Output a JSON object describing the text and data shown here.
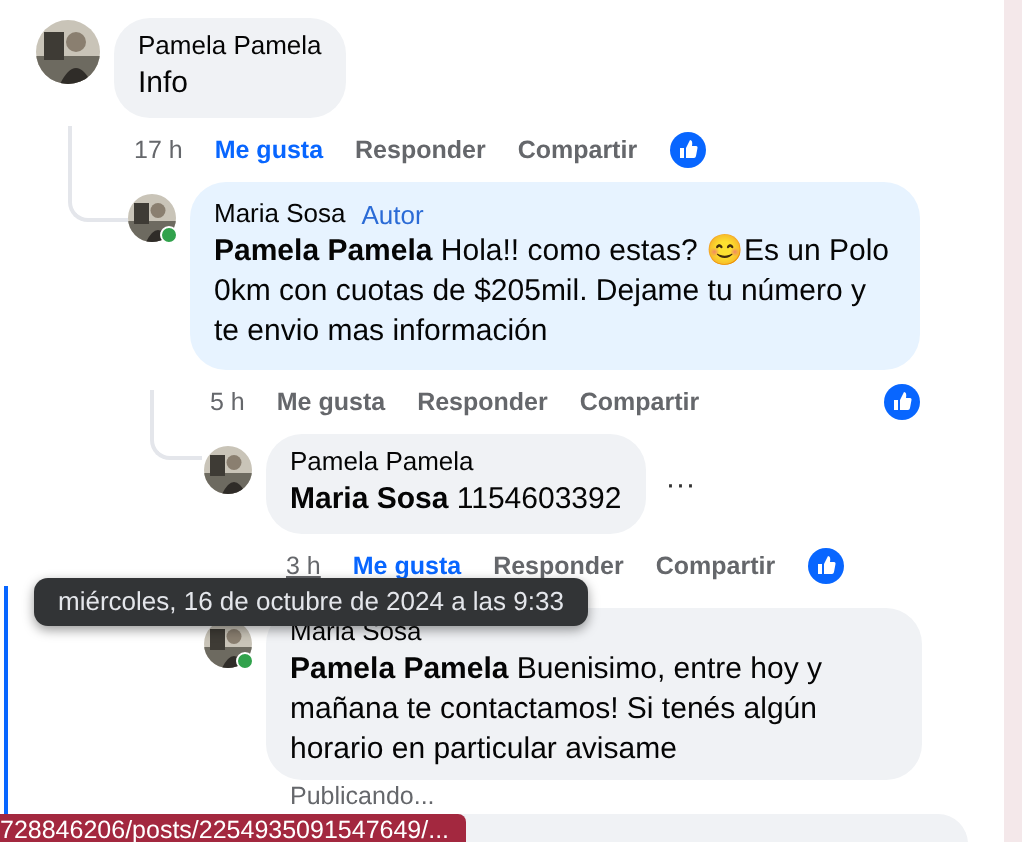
{
  "comments": [
    {
      "kind": "comment",
      "author": "Pamela Pamela",
      "text": "Info",
      "time": "17 h",
      "time_hovered": false,
      "like": "Me gusta",
      "liked": true,
      "reply": "Responder",
      "share": "Compartir",
      "children": [
        {
          "kind": "comment",
          "author": "Maria Sosa",
          "badge": "Autor",
          "text": "**Pamela Pamela** Hola!! como estas? 😊Es un Polo 0km con cuotas de $205mil. Dejame tu número y te envio mas información",
          "time": "5 h",
          "time_hovered": false,
          "like": "Me gusta",
          "liked": false,
          "reply": "Responder",
          "share": "Compartir",
          "online": true,
          "children": [
            {
              "kind": "comment",
              "author": "Pamela Pamela",
              "text": "**Maria Sosa** 1154603392",
              "time": "3 h",
              "time_hovered": true,
              "like": "Me gusta",
              "liked": true,
              "reply": "Responder",
              "share": "Compartir",
              "menu": "···"
            },
            {
              "kind": "comment",
              "author": "Maria Sosa",
              "text": "**Pamela Pamela** Buenisimo, entre hoy y mañana te contactamos! Si tenés algún horario en particular avisame",
              "status": "Publicando...",
              "online": true
            },
            {
              "kind": "placeholder"
            }
          ]
        }
      ]
    }
  ],
  "tooltip": {
    "text": "miércoles, 16 de octubre de 2024 a las 9:33"
  },
  "status_bar": {
    "url": "728846206/posts/2254935091547649/..."
  }
}
